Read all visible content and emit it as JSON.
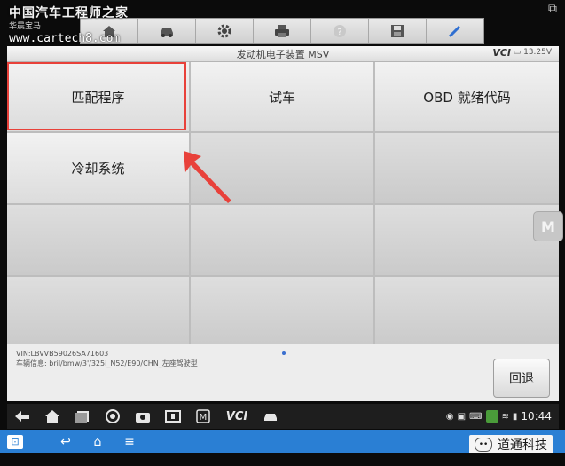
{
  "watermark": {
    "title": "中国汽车工程师之家",
    "sub": "华晨宝马",
    "url": "www.cartech8.com"
  },
  "toolbar": {
    "icons": [
      "home-icon",
      "car-icon",
      "gear-icon",
      "printer-icon",
      "help-icon",
      "save-icon",
      "pen-icon"
    ]
  },
  "header": {
    "title": "发动机电子装置 MSV",
    "vci": "VCI",
    "battery": "13.25V"
  },
  "grid": {
    "cells": [
      "匹配程序",
      "试车",
      "OBD 就绪代码",
      "冷却系统",
      "",
      "",
      "",
      "",
      "",
      "",
      "",
      ""
    ]
  },
  "info": {
    "vin": "VIN:LBVVB59026SA71603",
    "vehicle": "车辆信息: bril/bmw/3'/325i_N52/E90/CHN_左座驾驶型"
  },
  "buttons": {
    "back": "回退"
  },
  "android": {
    "vci": "VCI",
    "clock": "10:44"
  },
  "brand": {
    "name": "道通科技"
  },
  "colors": {
    "highlight": "#e8413a",
    "taskbar": "#2a7fd4"
  }
}
